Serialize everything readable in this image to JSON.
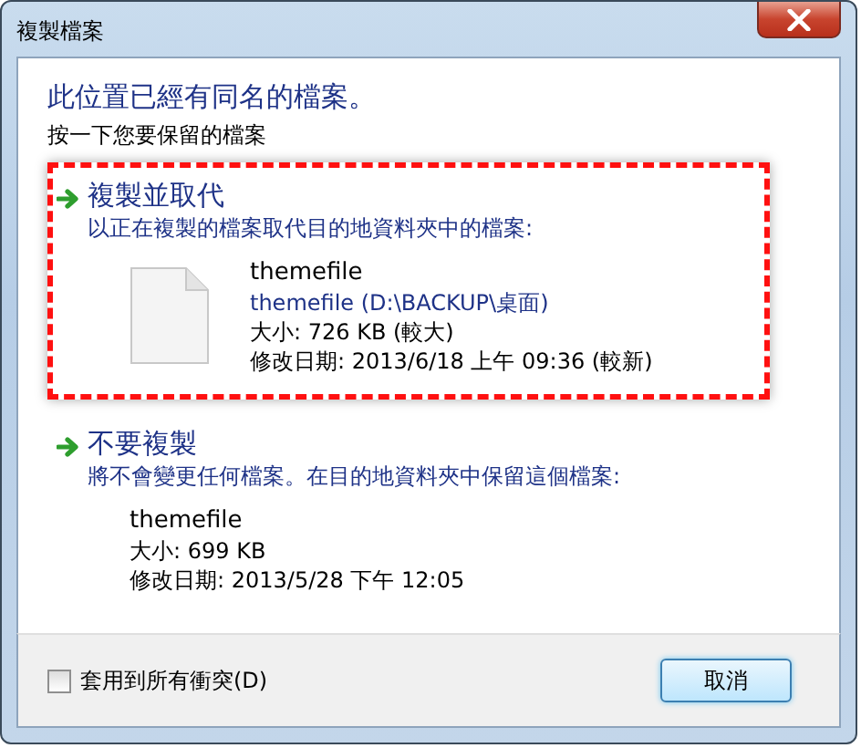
{
  "window": {
    "title": "複製檔案"
  },
  "heading": "此位置已經有同名的檔案。",
  "instruction": "按一下您要保留的檔案",
  "options": [
    {
      "kind": "replace",
      "highlighted": true,
      "title": "複製並取代",
      "description": "以正在複製的檔案取代目的地資料夾中的檔案:",
      "file": {
        "name": "themefile",
        "location": "themefile (D:\\BACKUP\\桌面)",
        "size": "大小: 726 KB (較大)",
        "modified": "修改日期: 2013/6/18 上午 09:36 (較新)"
      }
    },
    {
      "kind": "skip",
      "highlighted": false,
      "title": "不要複製",
      "description": "將不會變更任何檔案。在目的地資料夾中保留這個檔案:",
      "file": {
        "name": "themefile",
        "size": "大小: 699 KB",
        "modified": "修改日期: 2013/5/28 下午 12:05"
      }
    }
  ],
  "apply_all": {
    "label": "套用到所有衝突(D)",
    "checked": false
  },
  "buttons": [
    "取消"
  ]
}
